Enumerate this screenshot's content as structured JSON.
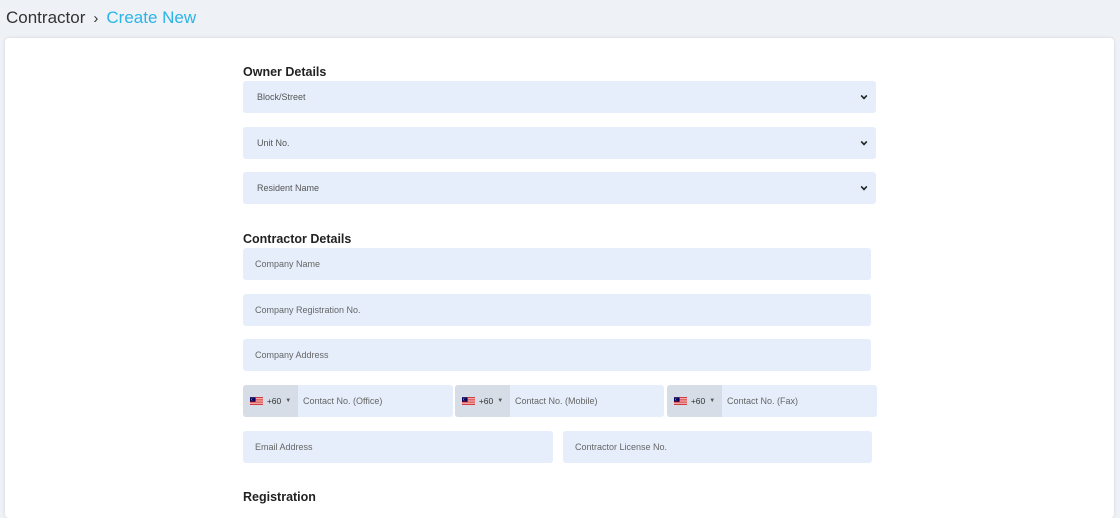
{
  "breadcrumb": {
    "root": "Contractor",
    "separator": "›",
    "current": "Create New"
  },
  "owner": {
    "title": "Owner Details",
    "block_street": "Block/Street",
    "unit_no": "Unit No.",
    "resident_name": "Resident Name"
  },
  "contractor": {
    "title": "Contractor Details",
    "company_name_ph": "Company Name",
    "company_reg_ph": "Company Registration No.",
    "company_address_ph": "Company Address",
    "phone_code": "+60",
    "office_ph": "Contact No. (Office)",
    "mobile_ph": "Contact No. (Mobile)",
    "fax_ph": "Contact No. (Fax)",
    "email_ph": "Email Address",
    "license_ph": "Contractor License No."
  },
  "registration": {
    "title": "Registration"
  },
  "colors": {
    "accent": "#2ab4e6",
    "field_bg": "#e5eefa",
    "page_bg": "#eef1f6"
  },
  "icons": {
    "select_arrow": "chevron-down-icon",
    "country_flag": "malaysia-flag-icon"
  }
}
